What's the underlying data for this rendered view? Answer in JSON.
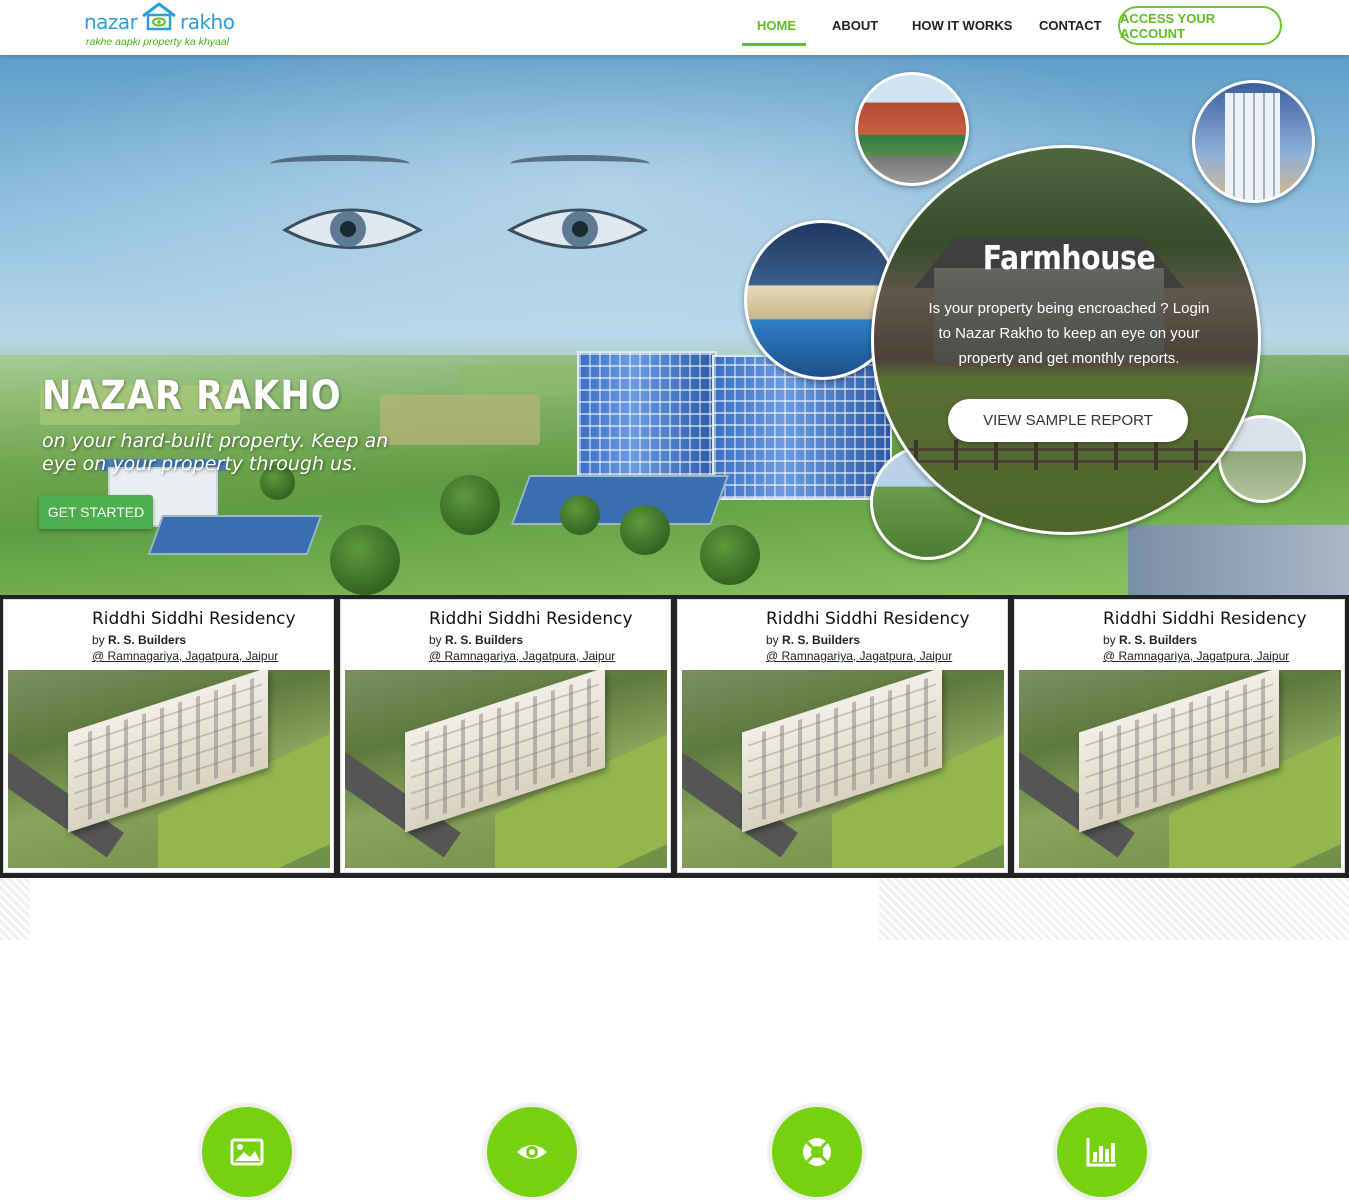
{
  "header": {
    "logo": {
      "word_left": "nazar",
      "word_right": "rakho",
      "tagline": "rakhe aapki property ka khyaal"
    },
    "nav": [
      {
        "label": "HOME",
        "active": true
      },
      {
        "label": "ABOUT",
        "active": false
      },
      {
        "label": "HOW IT WORKS",
        "active": false
      },
      {
        "label": "CONTACT",
        "active": false
      }
    ],
    "account_button": "ACCESS YOUR ACCOUNT"
  },
  "hero": {
    "title": "NAZAR RAKHO",
    "subtitle": "on your hard-built property. Keep an eye on your property through us.",
    "cta": "GET STARTED",
    "slide": {
      "title": "Farmhouse",
      "text": "Is your property being encroached ? Login to Nazar Rakho to keep an eye on your property and get monthly reports.",
      "button": "VIEW SAMPLE REPORT"
    }
  },
  "properties": [
    {
      "name": "Riddhi Siddhi Residency",
      "by_prefix": "by",
      "builder": "R. S. Builders",
      "location": "@ Ramnagariya, Jagatpura, Jaipur"
    },
    {
      "name": "Riddhi Siddhi Residency",
      "by_prefix": "by",
      "builder": "R. S. Builders",
      "location": "@ Ramnagariya, Jagatpura, Jaipur"
    },
    {
      "name": "Riddhi Siddhi Residency",
      "by_prefix": "by",
      "builder": "R. S. Builders",
      "location": "@ Ramnagariya, Jagatpura, Jaipur"
    },
    {
      "name": "Riddhi Siddhi Residency",
      "by_prefix": "by",
      "builder": "R. S. Builders",
      "location": "@ Ramnagariya, Jagatpura, Jaipur"
    }
  ],
  "features": [
    {
      "icon": "image-icon"
    },
    {
      "icon": "eye-icon"
    },
    {
      "icon": "life-ring-icon"
    },
    {
      "icon": "bar-chart-icon"
    }
  ],
  "colors": {
    "accent": "#5fbf22",
    "feature_circle": "#76d20f",
    "logo_blue": "#2a9fd6",
    "cta_green": "#4cae4c"
  }
}
